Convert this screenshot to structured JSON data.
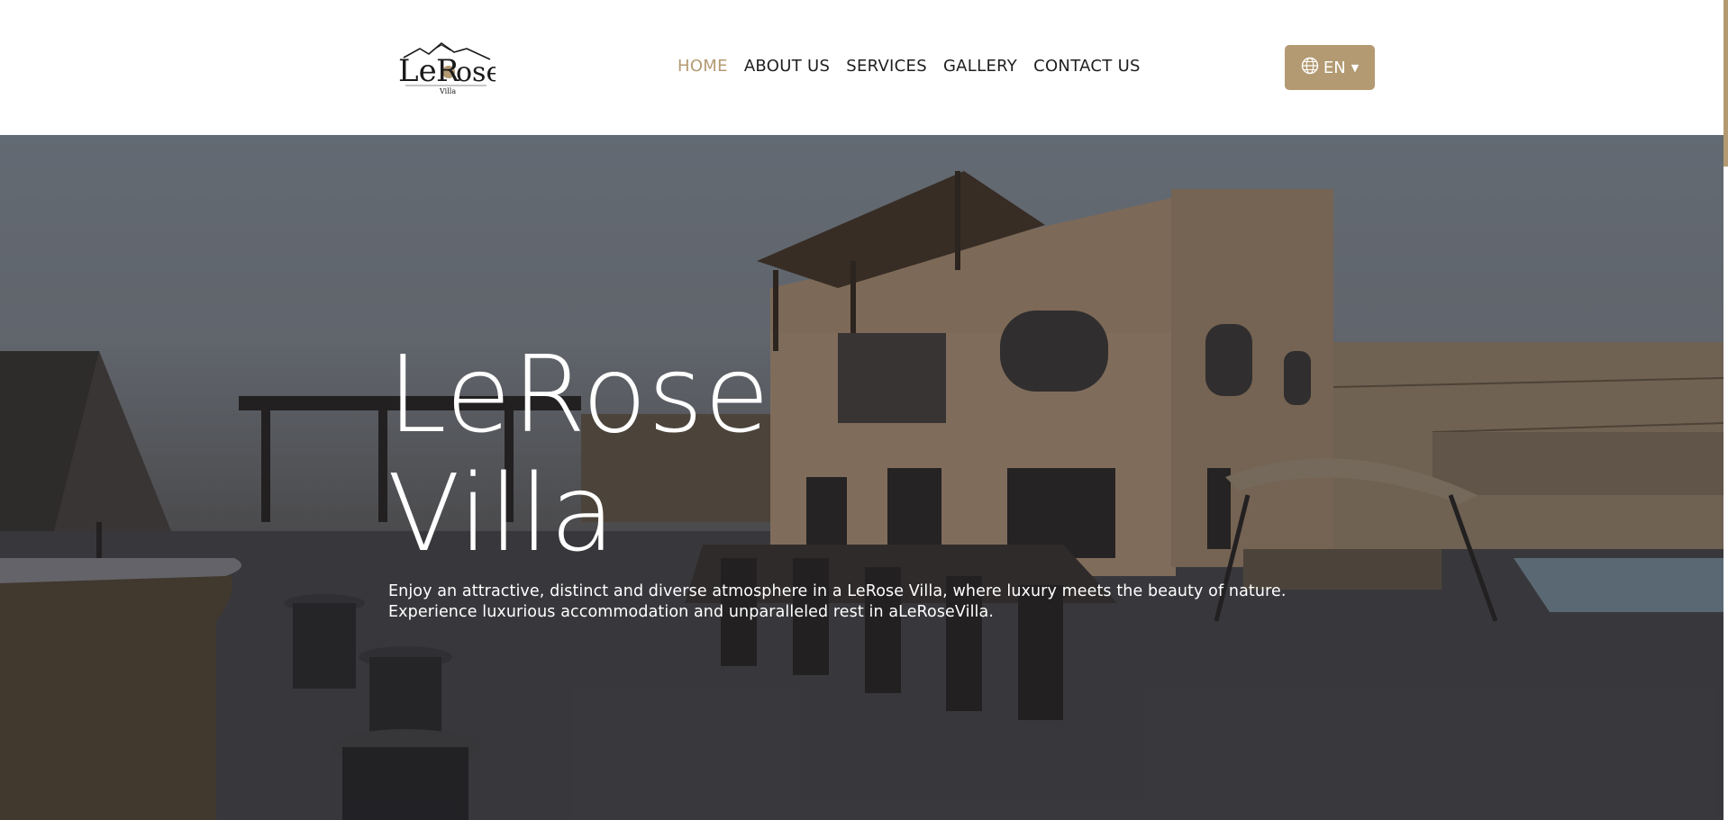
{
  "brand": {
    "logo_text": "Le Rose",
    "logo_subtext": "Villa"
  },
  "nav": {
    "items": [
      {
        "label": "HOME",
        "active": true
      },
      {
        "label": "ABOUT US",
        "active": false
      },
      {
        "label": "SERVICES",
        "active": false
      },
      {
        "label": "GALLERY",
        "active": false
      },
      {
        "label": "CONTACT US",
        "active": false
      }
    ]
  },
  "language": {
    "label": "EN",
    "icon": "globe-icon"
  },
  "hero": {
    "title_line1": "LeRose",
    "title_line2": "Villa",
    "text_line1": "Enjoy an attractive, distinct and diverse atmosphere in a LeRose Villa, where luxury meets the beauty of nature.",
    "text_line2": "Experience luxurious accommodation and unparalleled rest in aLeRoseVilla."
  },
  "colors": {
    "accent": "#b39a72",
    "nav_text": "#1e1e1e",
    "header_bg": "#ffffff"
  }
}
